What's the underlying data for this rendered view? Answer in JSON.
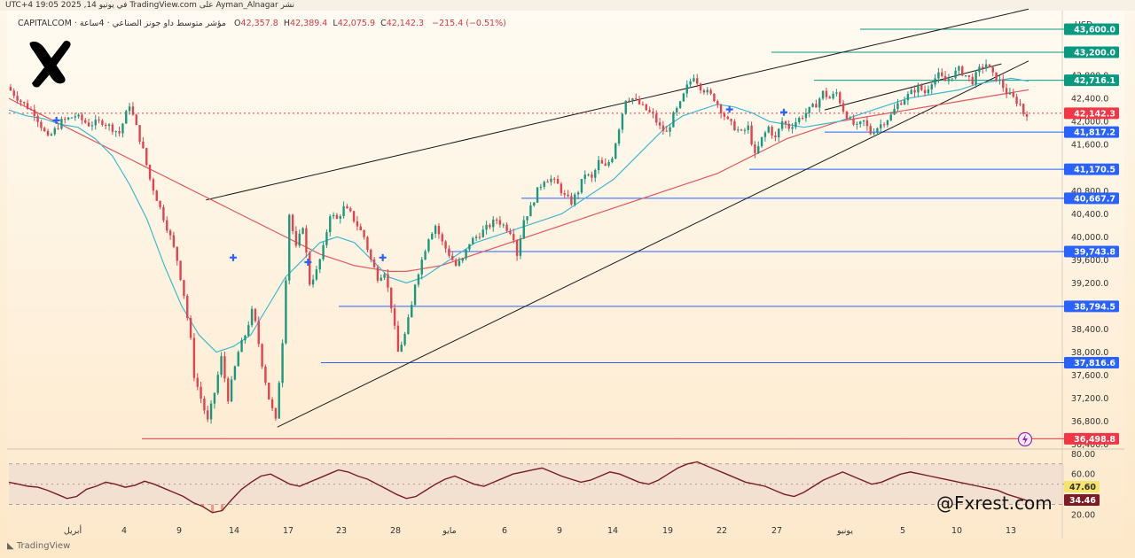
{
  "header": {
    "published": "نشر Ayman_Alnagar على TradingView.com في يونيو 14, 2025 19:05 UTC+4",
    "symbol": "مؤشر متوسط داو جونز الصناعي · 4ساعة · CAPITALCOM",
    "o_label": "O",
    "o_value": "42,357.8",
    "h_label": "H",
    "h_value": "42,389.4",
    "l_label": "L",
    "l_value": "42,075.9",
    "c_label": "C",
    "c_value": "42,142.3",
    "change": "−215.4 (−0.51%)",
    "currency": "USD"
  },
  "watermark": "@Fxrest.com",
  "footer_logo": "TradingView",
  "colors": {
    "up": "#17997f",
    "down": "#e2414d",
    "ema_fast": "#3fb8d0",
    "ema_slow": "#e0585e",
    "level_blue": "#2962ff",
    "level_green": "#089981",
    "level_red": "#f23645",
    "trendline": "#1c1c1c",
    "rsi": "#7b1b24"
  },
  "chart_data": [
    {
      "type": "candlestick",
      "title": "",
      "xlabel": "",
      "ylabel": "",
      "ylim": [
        36350,
        43800
      ],
      "x_ticks": [
        "أبريل",
        "4",
        "9",
        "14",
        "17",
        "23",
        "28",
        "مايو",
        "6",
        "9",
        "14",
        "19",
        "22",
        "27",
        "يونيو",
        "5",
        "10",
        "13"
      ],
      "y_ticks": [
        "42,800.0",
        "42,400.0",
        "42,000.0",
        "41,600.0",
        "40,800.0",
        "40,400.0",
        "40,000.0",
        "39,600.0",
        "39,200.0",
        "38,800.0",
        "38,400.0",
        "38,000.0",
        "37,600.0",
        "37,200.0",
        "36,800.0",
        "36,400.0"
      ],
      "y_tick_values": [
        42800,
        42400,
        42000,
        41600,
        40800,
        40400,
        40000,
        39600,
        39200,
        38800,
        38400,
        38000,
        37600,
        37200,
        36800,
        36400
      ],
      "price_path": [
        [
          0,
          42600
        ],
        [
          4,
          42350
        ],
        [
          8,
          42150
        ],
        [
          12,
          41700
        ],
        [
          16,
          42000
        ],
        [
          20,
          42100
        ],
        [
          24,
          41950
        ],
        [
          28,
          42000
        ],
        [
          33,
          41800
        ],
        [
          36,
          42300
        ],
        [
          40,
          41500
        ],
        [
          42,
          41000
        ],
        [
          45,
          40500
        ],
        [
          48,
          40000
        ],
        [
          50,
          39600
        ],
        [
          52,
          39000
        ],
        [
          54,
          38200
        ],
        [
          55,
          37600
        ],
        [
          57,
          37200
        ],
        [
          59,
          36800
        ],
        [
          61,
          37300
        ],
        [
          63,
          37900
        ],
        [
          65,
          37200
        ],
        [
          68,
          38000
        ],
        [
          70,
          38300
        ],
        [
          72,
          38700
        ],
        [
          73,
          38500
        ],
        [
          75,
          37800
        ],
        [
          77,
          37200
        ],
        [
          79,
          36800
        ],
        [
          81,
          38200
        ],
        [
          83,
          40400
        ],
        [
          85,
          39800
        ],
        [
          87,
          40200
        ],
        [
          89,
          39200
        ],
        [
          91,
          39400
        ],
        [
          93,
          39800
        ],
        [
          95,
          40400
        ],
        [
          97,
          40300
        ],
        [
          99,
          40500
        ],
        [
          101,
          40400
        ],
        [
          103,
          40200
        ],
        [
          105,
          40000
        ],
        [
          107,
          39600
        ],
        [
          109,
          39300
        ],
        [
          111,
          39400
        ],
        [
          113,
          38800
        ],
        [
          114,
          38400
        ],
        [
          115,
          38000
        ],
        [
          117,
          38300
        ],
        [
          119,
          38800
        ],
        [
          120,
          39200
        ],
        [
          122,
          39600
        ],
        [
          124,
          40000
        ],
        [
          126,
          40200
        ],
        [
          128,
          39900
        ],
        [
          130,
          39700
        ],
        [
          132,
          39500
        ],
        [
          134,
          39600
        ],
        [
          136,
          39900
        ],
        [
          138,
          40000
        ],
        [
          140,
          40100
        ],
        [
          142,
          40200
        ],
        [
          144,
          40300
        ],
        [
          146,
          40200
        ],
        [
          148,
          40100
        ],
        [
          149,
          40000
        ],
        [
          150,
          39700
        ],
        [
          152,
          40300
        ],
        [
          154,
          40500
        ],
        [
          156,
          40800
        ],
        [
          158,
          41000
        ],
        [
          160,
          41000
        ],
        [
          162,
          40900
        ],
        [
          164,
          40700
        ],
        [
          166,
          40600
        ],
        [
          168,
          40800
        ],
        [
          170,
          41100
        ],
        [
          172,
          41000
        ],
        [
          174,
          41300
        ],
        [
          176,
          41200
        ],
        [
          178,
          41400
        ],
        [
          180,
          41900
        ],
        [
          182,
          42400
        ],
        [
          184,
          42400
        ],
        [
          186,
          42300
        ],
        [
          188,
          42200
        ],
        [
          190,
          42100
        ],
        [
          192,
          41900
        ],
        [
          194,
          41800
        ],
        [
          196,
          42100
        ],
        [
          198,
          42300
        ],
        [
          200,
          42600
        ],
        [
          202,
          42800
        ],
        [
          204,
          42600
        ],
        [
          206,
          42500
        ],
        [
          208,
          42400
        ],
        [
          210,
          42200
        ],
        [
          212,
          42000
        ],
        [
          214,
          41900
        ],
        [
          216,
          41800
        ],
        [
          218,
          41900
        ],
        [
          220,
          41400
        ],
        [
          222,
          41700
        ],
        [
          224,
          41900
        ],
        [
          226,
          41700
        ],
        [
          228,
          42000
        ],
        [
          230,
          41900
        ],
        [
          232,
          42000
        ],
        [
          234,
          42100
        ],
        [
          236,
          42200
        ],
        [
          238,
          42300
        ],
        [
          240,
          42500
        ],
        [
          242,
          42400
        ],
        [
          244,
          42500
        ],
        [
          246,
          42200
        ],
        [
          248,
          42000
        ],
        [
          250,
          41900
        ],
        [
          252,
          42000
        ],
        [
          254,
          41800
        ],
        [
          256,
          41900
        ],
        [
          258,
          42000
        ],
        [
          260,
          42100
        ],
        [
          262,
          42300
        ],
        [
          264,
          42400
        ],
        [
          266,
          42500
        ],
        [
          268,
          42600
        ],
        [
          270,
          42500
        ],
        [
          272,
          42700
        ],
        [
          274,
          42800
        ],
        [
          276,
          42700
        ],
        [
          278,
          42800
        ],
        [
          280,
          42900
        ],
        [
          282,
          42800
        ],
        [
          284,
          42700
        ],
        [
          286,
          42900
        ],
        [
          288,
          43000
        ],
        [
          290,
          42800
        ],
        [
          292,
          42700
        ],
        [
          294,
          42500
        ],
        [
          296,
          42400
        ],
        [
          298,
          42300
        ],
        [
          299,
          42142
        ]
      ],
      "emas": [
        {
          "name": "",
          "values": [
            42400,
            42250,
            42100,
            41950,
            41800,
            41650,
            41500,
            41350,
            41200,
            41050,
            40900,
            40750,
            40600,
            40450,
            40300,
            40150,
            40000,
            39850,
            39700,
            39600,
            39500,
            39450,
            39400,
            39400,
            39450,
            39500,
            39600,
            39700,
            39800,
            39900,
            40000,
            40100,
            40200,
            40300,
            40400,
            40500,
            40600,
            40700,
            40800,
            40900,
            41000,
            41100,
            41250,
            41400,
            41550,
            41700,
            41800,
            41900,
            42000,
            42050,
            42100,
            42150,
            42200,
            42250,
            42300,
            42350,
            42400,
            42450,
            42500,
            42550
          ]
        },
        {
          "name": "",
          "values": [
            42200,
            42100,
            42050,
            41950,
            41900,
            41700,
            41400,
            40900,
            40300,
            39500,
            38800,
            38300,
            38000,
            38100,
            38300,
            38800,
            39300,
            39600,
            39900,
            40000,
            39900,
            39600,
            39300,
            39200,
            39300,
            39500,
            39700,
            39900,
            40000,
            40100,
            40200,
            40300,
            40400,
            40600,
            40800,
            41000,
            41300,
            41600,
            41900,
            42100,
            42200,
            42300,
            42250,
            42150,
            42000,
            41950,
            41900,
            41950,
            42000,
            42100,
            42200,
            42300,
            42400,
            42450,
            42500,
            42550,
            42650,
            42700,
            42750,
            42700
          ]
        }
      ],
      "levels": [
        {
          "label": "43,600.0",
          "value": 43600,
          "color": "green"
        },
        {
          "label": "43,200.0",
          "value": 43200,
          "color": "green"
        },
        {
          "label": "42,716.1",
          "value": 42716.1,
          "color": "green"
        },
        {
          "label": "42,142.3",
          "value": 42142.3,
          "color": "red"
        },
        {
          "label": "41,817.2",
          "value": 41817.2,
          "color": "blue"
        },
        {
          "label": "41,170.5",
          "value": 41170.5,
          "color": "blue"
        },
        {
          "label": "40,667.7",
          "value": 40667.7,
          "color": "blue"
        },
        {
          "label": "39,743.8",
          "value": 39743.8,
          "color": "blue"
        },
        {
          "label": "38,794.5",
          "value": 38794.5,
          "color": "blue"
        },
        {
          "label": "37,816.6",
          "value": 37816.6,
          "color": "blue"
        },
        {
          "label": "36,498.8",
          "value": 36498.8,
          "color": "red"
        }
      ],
      "trendlines": [
        {
          "from": [
            58,
            40640
          ],
          "to": [
            300,
            43950
          ]
        },
        {
          "from": [
            79,
            36700
          ],
          "to": [
            300,
            43050
          ]
        }
      ]
    },
    {
      "type": "line",
      "title": "",
      "xlabel": "",
      "ylabel": "",
      "ylim": [
        14,
        82
      ],
      "y_ticks": [
        "80.00",
        "60.00",
        "20.00"
      ],
      "y_tick_values": [
        80,
        60,
        20
      ],
      "levels": [
        {
          "label": "47.60",
          "value": 47.6
        },
        {
          "label": "34.46",
          "value": 34.46
        }
      ],
      "bands": [
        70,
        30
      ],
      "values": [
        52,
        50,
        48,
        47,
        44,
        40,
        36,
        38,
        45,
        48,
        52,
        50,
        47,
        49,
        53,
        50,
        46,
        42,
        38,
        32,
        28,
        22,
        24,
        35,
        45,
        52,
        58,
        60,
        55,
        50,
        48,
        52,
        56,
        60,
        64,
        62,
        58,
        55,
        50,
        45,
        40,
        36,
        38,
        44,
        50,
        55,
        58,
        54,
        50,
        48,
        52,
        56,
        60,
        62,
        64,
        66,
        62,
        58,
        55,
        52,
        54,
        58,
        62,
        60,
        56,
        52,
        50,
        54,
        60,
        66,
        70,
        72,
        68,
        64,
        60,
        56,
        52,
        50,
        48,
        44,
        40,
        38,
        42,
        48,
        54,
        58,
        62,
        58,
        54,
        50,
        52,
        56,
        60,
        62,
        60,
        58,
        56,
        54,
        52,
        50,
        48,
        46,
        44,
        40,
        37,
        34
      ]
    }
  ]
}
